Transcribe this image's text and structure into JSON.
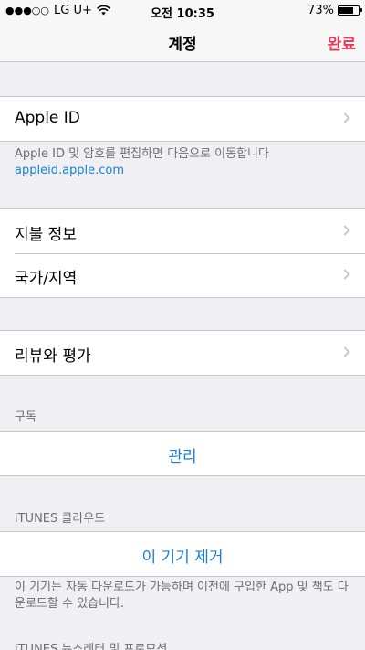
{
  "status": {
    "signal": "●●●○○",
    "carrier": "LG U+",
    "time": "오전 10:35",
    "battery_text": "73%",
    "battery_level": 0.73
  },
  "nav": {
    "title": "계정",
    "done": "완료"
  },
  "apple_id": {
    "label": "Apple ID",
    "footer": "Apple ID 및 암호를 편집하면 다음으로 이동합니다",
    "link": "appleid.apple.com"
  },
  "payment": {
    "billing_label": "지불 정보",
    "region_label": "국가/지역"
  },
  "reviews": {
    "label": "리뷰와 평가"
  },
  "subscriptions": {
    "header": "구독",
    "manage": "관리"
  },
  "itunes_cloud": {
    "header": "iTUNES 클라우드",
    "remove_device": "이 기기 제거",
    "footer": "이 기기는 자동 다운로드가 가능하며 이전에 구입한 App 및 책도 다운로드할 수 있습니다."
  },
  "newsletter": {
    "header": "iTUNES 뉴스레터 및 프로모션"
  },
  "colors": {
    "accent_red": "#e8385a",
    "link_blue": "#1a7fd4",
    "background": "#efeff4"
  }
}
